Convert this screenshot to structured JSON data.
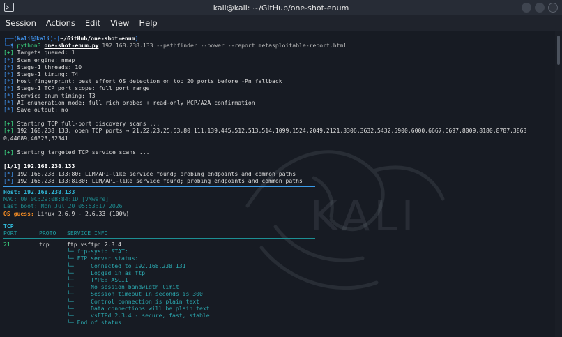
{
  "window": {
    "title": "kali@kali: ~/GitHub/one-shot-enum"
  },
  "menu": {
    "items": [
      "Session",
      "Actions",
      "Edit",
      "View",
      "Help"
    ]
  },
  "watermark": "KALI",
  "prompt": {
    "open": "┌──(",
    "user": "kali",
    "at": "㉿",
    "host": "kali",
    "mid": ")-[",
    "path": "~/GitHub/one-shot-enum",
    "close": "]",
    "line2": "└─",
    "dollar": "$",
    "cmd": "python3",
    "script": "one-shot-enum.py",
    "args": "192.168.238.133 --pathfinder --power --report metasploitable-report.html"
  },
  "config_lines": [
    "Targets queued: 1",
    "Scan engine: nmap",
    "Stage-1 threads: 10",
    "Stage-1 timing: T4",
    "Host fingerprint: best effort OS detection on top 20 ports before -Pn fallback",
    "Stage-1 TCP port scope: full port range",
    "Service enum timing: T3",
    "AI enumeration mode: full rich probes + read-only MCP/A2A confirmation",
    "Save output: no"
  ],
  "discovery": {
    "start": "Starting TCP full-port discovery scans ...",
    "result1": "192.168.238.133: open TCP ports → 21,22,23,25,53,80,111,139,445,512,513,514,1099,1524,2049,2121,3306,3632,5432,5900,6000,6667,6697,8009,8180,8787,3863",
    "result2": "0,44089,46323,52341"
  },
  "targeted": "Starting targeted TCP service scans ...",
  "progress": "[1/1] 192.168.238.133",
  "llm": [
    "192.168.238.133:80: LLM/API-like service found; probing endpoints and common paths",
    "192.168.238.133:8180: LLM/API-like service found; probing endpoints and common paths"
  ],
  "host": {
    "host_line": "Host: 192.168.238.133",
    "mac": "MAC: 00:0C:29:0B:84:1D [VMware]",
    "boot": "Last boot: Mon Jul 20 05:53:17 2026",
    "os_label": "OS guess:",
    "os_value": "Linux 2.6.9 - 2.6.33 (100%)"
  },
  "table": {
    "section": "TCP",
    "headers": [
      "PORT",
      "PROTO",
      "SERVICE INFO"
    ],
    "row": {
      "port": "21",
      "proto": "tcp",
      "service": "ftp vsftpd 2.3.4"
    },
    "details": [
      "└─ ftp-syst: STAT:",
      "└─ FTP server status:",
      "└─     Connected to 192.168.238.131",
      "└─     Logged in as ftp",
      "└─     TYPE: ASCII",
      "└─     No session bandwidth limit",
      "└─     Session timeout in seconds is 300",
      "└─     Control connection is plain text",
      "└─     Data connections will be plain text",
      "└─     vsFTPd 2.3.4 - secure, fast, stable",
      "└─ End of status"
    ]
  },
  "colors": {
    "bracket_blue": "#2e7fe0",
    "prompt_blue": "#3f8fe6",
    "plus_green": "#3ddc84",
    "teal": "#1f9ea3",
    "os_orange": "#f08a24"
  }
}
